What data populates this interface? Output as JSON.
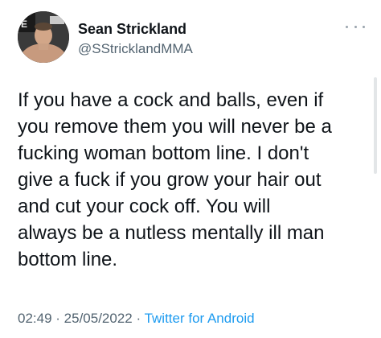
{
  "user": {
    "name": "Sean Strickland",
    "handle": "@SStricklandMMA"
  },
  "tweet": {
    "lines": [
      "If you have a cock and balls, even if",
      "you remove them you will never be a",
      "fucking woman bottom line. I don't",
      "give a fuck if you grow your hair out",
      "and cut your cock off. You will",
      "always be a nutless mentally ill man",
      "bottom line."
    ]
  },
  "meta": {
    "time": "02:49",
    "separator": " · ",
    "date": "25/05/2022",
    "source": "Twitter for Android"
  },
  "icons": {
    "more": "more-options-icon"
  },
  "colors": {
    "text": "#0f1419",
    "secondary": "#536471",
    "link": "#1d9bf0"
  }
}
